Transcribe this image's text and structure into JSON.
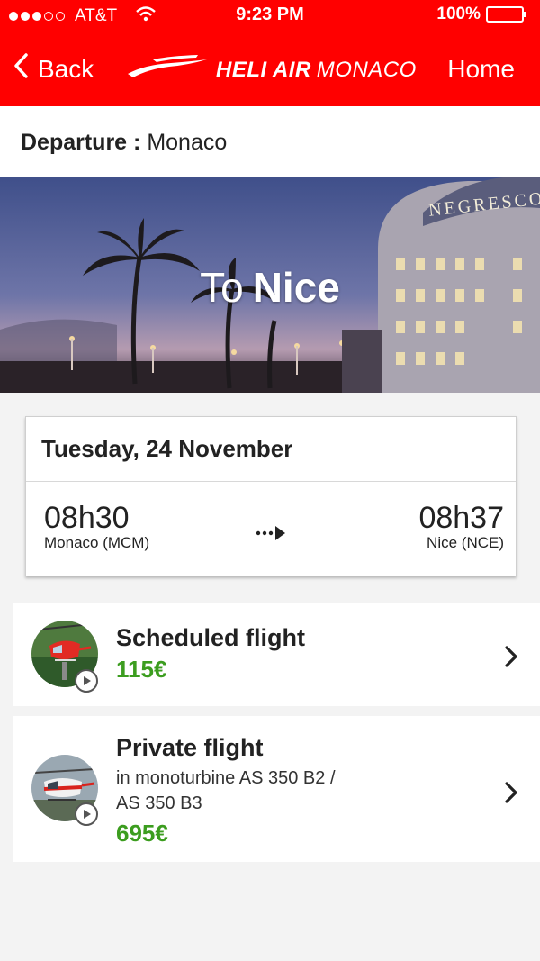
{
  "status_bar": {
    "carrier": "AT&T",
    "time": "9:23 PM",
    "battery": "100%",
    "signal_bars_filled": 3,
    "signal_bars_total": 5
  },
  "nav": {
    "back_label": "Back",
    "logo_bold": "HELI AIR",
    "logo_light": "MONACO",
    "home_label": "Home"
  },
  "departure": {
    "label": "Departure :",
    "value": "Monaco"
  },
  "hero": {
    "prefix": "To",
    "destination": "Nice",
    "sign_text": "NEGRESCO"
  },
  "schedule": {
    "date": "Tuesday, 24 November",
    "departure_time": "08h30",
    "departure_place": "Monaco (MCM)",
    "arrival_time": "08h37",
    "arrival_place": "Nice (NCE)"
  },
  "options": [
    {
      "title": "Scheduled flight",
      "price": "115€"
    },
    {
      "title": "Private flight",
      "subtitle_line1": "in monoturbine AS 350 B2 /",
      "subtitle_line2": "AS 350 B3",
      "price": "695€"
    }
  ],
  "colors": {
    "brand_red": "#ff0000",
    "price_green": "#3c9d1f",
    "background": "#f3f3f3"
  },
  "icons": [
    "wifi-icon",
    "battery-icon",
    "chevron-left-icon",
    "logo-swoosh-icon",
    "arrow-right-icon",
    "chevron-right-icon",
    "play-icon"
  ]
}
